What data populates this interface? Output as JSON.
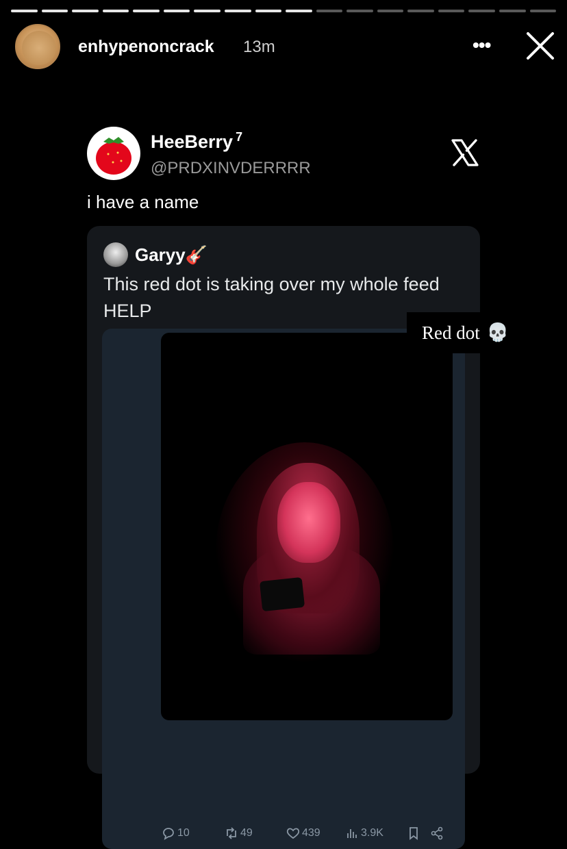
{
  "story": {
    "segments_total": 18,
    "segments_viewed": 10,
    "username": "enhypenoncrack",
    "time": "13m",
    "more_label": "•••",
    "close_icon": "close-icon"
  },
  "tweet": {
    "display_name": "HeeBerry",
    "name_suffix": "7",
    "handle": "@PRDXINVDERRRR",
    "text": "i have a name",
    "logo": "x-logo-icon",
    "quoted": {
      "name": "Garyy",
      "emoji": "🎸",
      "text": "This red dot is taking over my whole feed HELP",
      "stats": {
        "replies": "10",
        "reposts": "49",
        "likes": "439",
        "views": "3.9K"
      }
    }
  },
  "sticker": {
    "text": "Red dot",
    "emoji": "💀"
  },
  "colors": {
    "background": "#000000",
    "quote_card": "#15181c",
    "muted_text": "#9a9a9a",
    "action_icons": "#8b98a5"
  }
}
